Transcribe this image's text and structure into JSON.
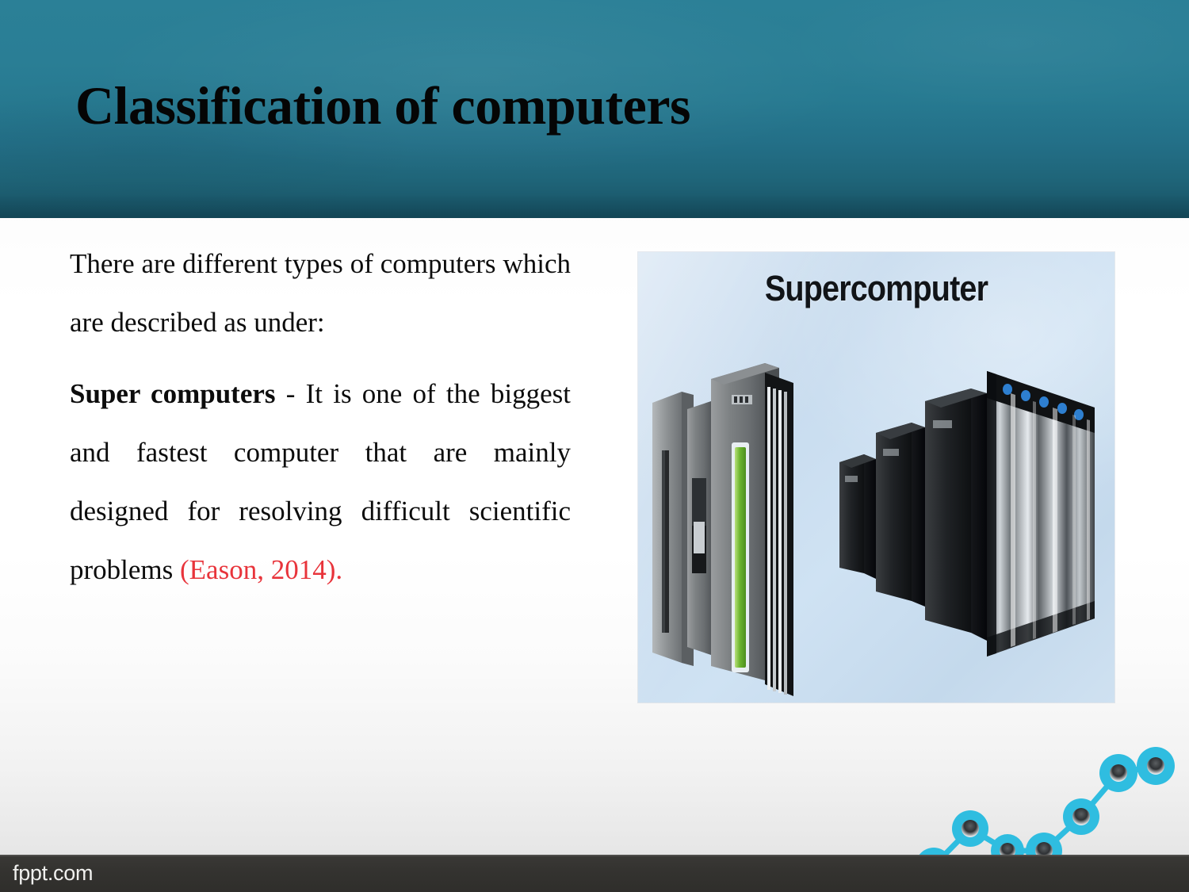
{
  "slide": {
    "title": "Classification of computers",
    "header_color_top": "#2b8097",
    "header_color_bottom": "#1a5467"
  },
  "content": {
    "paragraph_1": "There are different types of computers which are described as under:",
    "paragraph_2": {
      "lead": "Super computers",
      "body": " - It is one of the biggest and fastest computer that are mainly designed for resolving difficult scientific problems ",
      "citation": "(Eason, 2014).",
      "citation_color": "#e8343b"
    }
  },
  "picture": {
    "caption": "Supercomputer",
    "background_color": "#c8dcef",
    "alt": "supercomputer-server-racks-illustration"
  },
  "footer": {
    "brand": "fppt.com",
    "background_color": "#333330"
  },
  "chart_data": {
    "type": "line",
    "title": "",
    "xlabel": "",
    "ylabel": "",
    "x": [
      0,
      1,
      2,
      3,
      4,
      5,
      6
    ],
    "values": [
      1,
      4,
      2,
      2,
      5,
      7,
      7.4
    ],
    "xlim": [
      0,
      6
    ],
    "ylim": [
      0,
      8
    ],
    "grid": false,
    "legend": null,
    "marker_color": "#2fbde0",
    "line_color": "#2fbde0",
    "marker_style": "donut",
    "annotations": [
      "decorative chart graphic in slide footer"
    ]
  }
}
